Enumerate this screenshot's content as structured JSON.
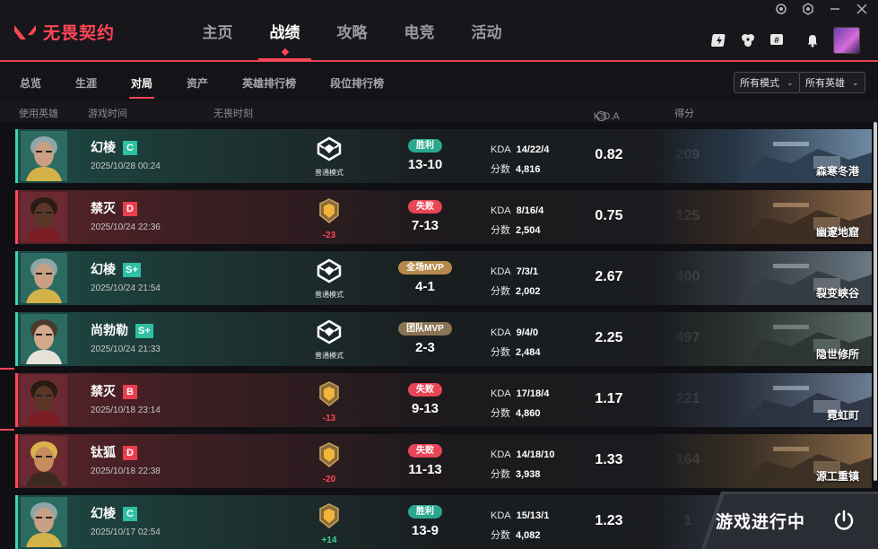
{
  "app": {
    "title": "无畏契约",
    "brand_color": "#ff4655"
  },
  "main_nav": [
    {
      "label": "主页",
      "active": false
    },
    {
      "label": "战绩",
      "active": true
    },
    {
      "label": "攻略",
      "active": false
    },
    {
      "label": "电竞",
      "active": false
    },
    {
      "label": "活动",
      "active": false
    }
  ],
  "sub_nav": [
    {
      "label": "总览",
      "active": false
    },
    {
      "label": "生涯",
      "active": false
    },
    {
      "label": "对局",
      "active": true
    },
    {
      "label": "资产",
      "active": false
    },
    {
      "label": "英雄排行榜",
      "active": false
    },
    {
      "label": "段位排行榜",
      "active": false
    }
  ],
  "filters": {
    "mode": "所有模式",
    "agent": "所有英雄"
  },
  "columns": {
    "agent": "使用英雄",
    "time": "游戏时间",
    "moment": "无畏时刻",
    "kda": "K.D.A",
    "score": "得分"
  },
  "labels": {
    "kda": "KDA",
    "points": "分数"
  },
  "matches": [
    {
      "agent": "幻棱",
      "rank": "C",
      "rank_color": "teal",
      "date": "2025/10/28 00:24",
      "mode": "普通模式",
      "mode_type": "normal",
      "delta": "",
      "result": "胜利",
      "result_type": "win",
      "outcome": "win",
      "score": "13-10",
      "kda": "14/22/4",
      "points": "4,816",
      "ratio": "0.82",
      "total": "209",
      "map": "森寒冬港"
    },
    {
      "agent": "禁灭",
      "rank": "D",
      "rank_color": "red",
      "date": "2025/10/24 22:36",
      "mode": "",
      "mode_type": "ranked",
      "delta": "-23",
      "result": "失败",
      "result_type": "lose",
      "outcome": "lose",
      "score": "7-13",
      "kda": "8/16/4",
      "points": "2,504",
      "ratio": "0.75",
      "total": "125",
      "map": "幽邃地窟"
    },
    {
      "agent": "幻棱",
      "rank": "S+",
      "rank_color": "teal",
      "date": "2025/10/24 21:54",
      "mode": "普通模式",
      "mode_type": "normal",
      "delta": "",
      "result": "全场MVP",
      "result_type": "mvp",
      "outcome": "win",
      "score": "4-1",
      "kda": "7/3/1",
      "points": "2,002",
      "ratio": "2.67",
      "total": "400",
      "map": "裂变峡谷"
    },
    {
      "agent": "尚勃勒",
      "rank": "S+",
      "rank_color": "teal",
      "date": "2025/10/24 21:33",
      "mode": "普通模式",
      "mode_type": "normal",
      "delta": "",
      "result": "团队MVP",
      "result_type": "team",
      "outcome": "win",
      "score": "2-3",
      "kda": "9/4/0",
      "points": "2,484",
      "ratio": "2.25",
      "total": "497",
      "map": "隐世修所"
    },
    {
      "agent": "禁灭",
      "rank": "B",
      "rank_color": "red",
      "date": "2025/10/18 23:14",
      "mode": "",
      "mode_type": "ranked",
      "delta": "-13",
      "result": "失败",
      "result_type": "lose",
      "outcome": "lose",
      "score": "9-13",
      "kda": "17/18/4",
      "points": "4,860",
      "ratio": "1.17",
      "total": "221",
      "map": "霓虹町"
    },
    {
      "agent": "钛狐",
      "rank": "D",
      "rank_color": "red",
      "date": "2025/10/18 22:38",
      "mode": "",
      "mode_type": "ranked",
      "delta": "-20",
      "result": "失败",
      "result_type": "lose",
      "outcome": "lose",
      "score": "11-13",
      "kda": "14/18/10",
      "points": "3,938",
      "ratio": "1.33",
      "total": "164",
      "map": "源工重镇"
    },
    {
      "agent": "幻棱",
      "rank": "C",
      "rank_color": "teal",
      "date": "2025/10/17 02:54",
      "mode": "",
      "mode_type": "ranked",
      "delta": "+14",
      "result": "胜利",
      "result_type": "win",
      "outcome": "win",
      "score": "13-9",
      "kda": "15/13/1",
      "points": "4,082",
      "ratio": "1.23",
      "total": "1",
      "map": ""
    }
  ],
  "in_game": {
    "label": "游戏进行中"
  }
}
